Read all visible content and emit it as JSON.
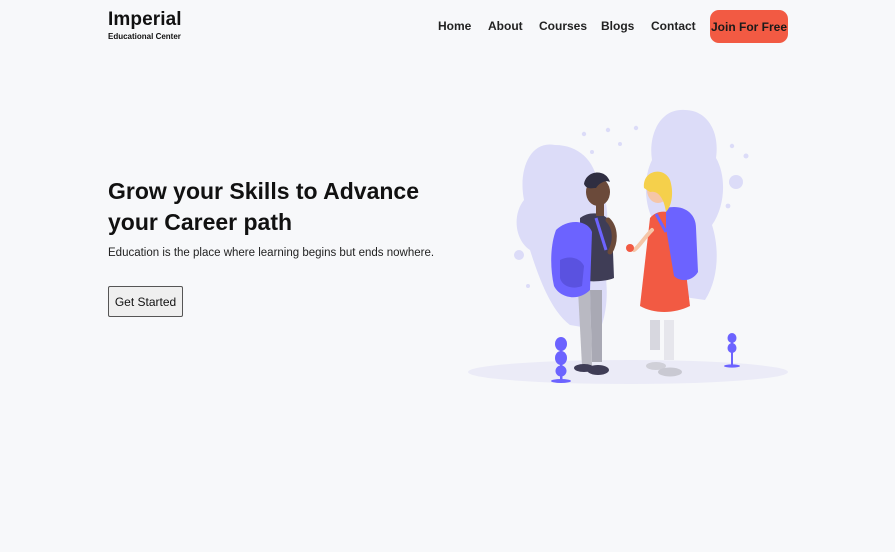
{
  "brand": {
    "name": "Imperial",
    "tagline": "Educational Center"
  },
  "nav": {
    "items": [
      {
        "label": "Home"
      },
      {
        "label": "About"
      },
      {
        "label": "Courses"
      },
      {
        "label": "Blogs"
      },
      {
        "label": "Contact"
      }
    ],
    "cta_label": "Join For Free"
  },
  "hero": {
    "title": "Grow your Skills to Advance your Career path",
    "subtitle": "Education is the place where learning begins but ends nowhere.",
    "button_label": "Get Started"
  },
  "colors": {
    "background": "#f7f8fa",
    "accent_orange": "#f25a43",
    "accent_purple": "#6c63ff",
    "blob_lavender": "#dcdcf8"
  },
  "illustration": {
    "icon": "students-with-backpacks-illustration"
  }
}
